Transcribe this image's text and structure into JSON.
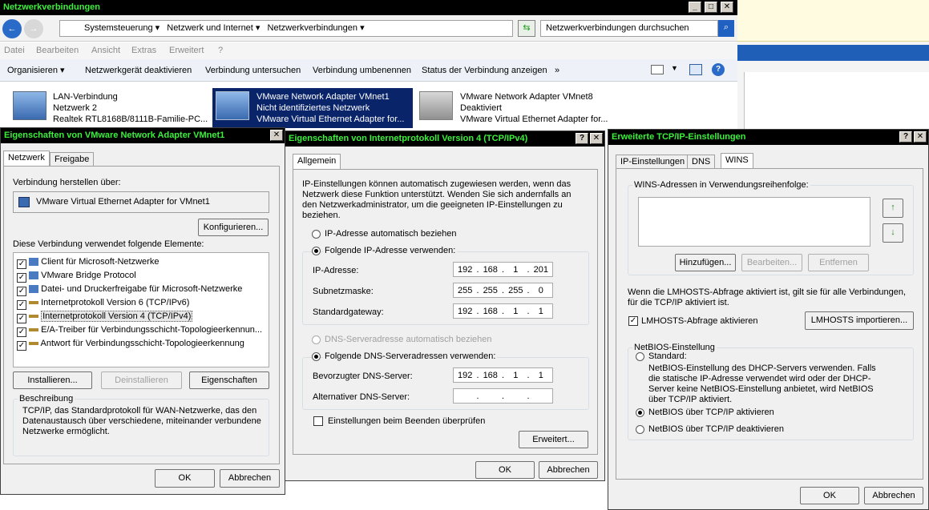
{
  "explorer": {
    "title": "Netzwerkverbindungen",
    "breadcrumb": [
      "Systemsteuerung",
      "Netzwerk und Internet",
      "Netzwerkverbindungen"
    ],
    "search_placeholder": "Netzwerkverbindungen durchsuchen",
    "menu": [
      "Datei",
      "Bearbeiten",
      "Ansicht",
      "Extras",
      "Erweitert",
      "?"
    ],
    "toolbar": [
      "Organisieren ▾",
      "Netzwerkgerät deaktivieren",
      "Verbindung untersuchen",
      "Verbindung umbenennen",
      "Status der Verbindung anzeigen",
      "»"
    ],
    "connections": [
      {
        "name": "LAN-Verbindung",
        "status": "Netzwerk  2",
        "adapter": "Realtek RTL8168B/8111B-Familie-PC..."
      },
      {
        "name": "VMware Network Adapter VMnet1",
        "status": "Nicht identifiziertes Netzwerk",
        "adapter": "VMware Virtual Ethernet Adapter for..."
      },
      {
        "name": "VMware Network Adapter VMnet8",
        "status": "Deaktiviert",
        "adapter": "VMware Virtual Ethernet Adapter for..."
      }
    ]
  },
  "dlg1": {
    "title": "Eigenschaften von VMware Network Adapter VMnet1",
    "tabs": [
      "Netzwerk",
      "Freigabe"
    ],
    "connect_label": "Verbindung herstellen über:",
    "adapter": "VMware Virtual Ethernet Adapter for VMnet1",
    "configure": "Konfigurieren...",
    "items_label": "Diese Verbindung verwendet folgende Elemente:",
    "items": [
      {
        "label": "Client für Microsoft-Netzwerke",
        "checked": true
      },
      {
        "label": "VMware Bridge Protocol",
        "checked": true
      },
      {
        "label": "Datei- und Druckerfreigabe für Microsoft-Netzwerke",
        "checked": true
      },
      {
        "label": "Internetprotokoll Version 6 (TCP/IPv6)",
        "checked": true
      },
      {
        "label": "Internetprotokoll Version 4 (TCP/IPv4)",
        "checked": true
      },
      {
        "label": "E/A-Treiber für Verbindungsschicht-Topologieerkennun...",
        "checked": true
      },
      {
        "label": "Antwort für Verbindungsschicht-Topologieerkennung",
        "checked": true
      }
    ],
    "install": "Installieren...",
    "uninstall": "Deinstallieren",
    "properties": "Eigenschaften",
    "desc_title": "Beschreibung",
    "desc": "TCP/IP, das Standardprotokoll für WAN-Netzwerke, das den Datenaustausch über verschiedene, miteinander verbundene Netzwerke ermöglicht.",
    "ok": "OK",
    "cancel": "Abbrechen"
  },
  "dlg2": {
    "title": "Eigenschaften von Internetprotokoll Version 4 (TCP/IPv4)",
    "tab": "Allgemein",
    "intro": "IP-Einstellungen können automatisch zugewiesen werden, wenn das Netzwerk diese Funktion unterstützt. Wenden Sie sich andernfalls an den Netzwerkadministrator, um die geeigneten IP-Einstellungen zu beziehen.",
    "auto_ip": "IP-Adresse automatisch beziehen",
    "manual_ip": "Folgende IP-Adresse verwenden:",
    "ip_label": "IP-Adresse:",
    "ip": [
      "192",
      "168",
      "1",
      "201"
    ],
    "mask_label": "Subnetzmaske:",
    "mask": [
      "255",
      "255",
      "255",
      "0"
    ],
    "gw_label": "Standardgateway:",
    "gw": [
      "192",
      "168",
      "1",
      "1"
    ],
    "auto_dns": "DNS-Serveradresse automatisch beziehen",
    "manual_dns": "Folgende DNS-Serveradressen verwenden:",
    "dns1_label": "Bevorzugter DNS-Server:",
    "dns1": [
      "192",
      "168",
      "1",
      "1"
    ],
    "dns2_label": "Alternativer DNS-Server:",
    "validate": "Einstellungen beim Beenden überprüfen",
    "advanced": "Erweitert...",
    "ok": "OK",
    "cancel": "Abbrechen"
  },
  "dlg3": {
    "title": "Erweiterte TCP/IP-Einstellungen",
    "tabs": [
      "IP-Einstellungen",
      "DNS",
      "WINS"
    ],
    "wins_label": "WINS-Adressen in Verwendungsreihenfolge:",
    "add": "Hinzufügen...",
    "edit": "Bearbeiten...",
    "remove": "Entfernen",
    "lmhosts_info": "Wenn die LMHOSTS-Abfrage aktiviert ist, gilt sie für alle Verbindungen, für die TCP/IP aktiviert ist.",
    "lmhosts_check": "LMHOSTS-Abfrage aktivieren",
    "lmhosts_import": "LMHOSTS importieren...",
    "netbios_group": "NetBIOS-Einstellung",
    "std": "Standard:",
    "std_desc": "NetBIOS-Einstellung des DHCP-Servers verwenden. Falls die statische IP-Adresse verwendet wird oder der DHCP-Server keine NetBIOS-Einstellung anbietet, wird NetBIOS über TCP/IP aktiviert.",
    "enable": "NetBIOS über TCP/IP aktivieren",
    "disable": "NetBIOS über TCP/IP deaktivieren",
    "ok": "OK",
    "cancel": "Abbrechen"
  },
  "colors": {
    "title_fg": "#3bf03b",
    "selection": "#0a246a"
  }
}
